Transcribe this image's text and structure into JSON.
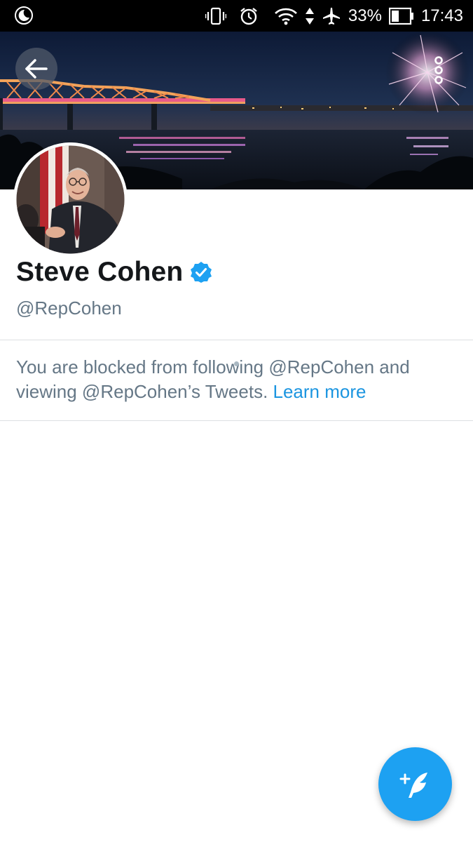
{
  "status_bar": {
    "battery_percent": "33%",
    "time": "17:43",
    "icons": [
      "moon-icon",
      "vibrate-icon",
      "alarm-icon",
      "wifi-icon",
      "data-arrows-icon",
      "airplane-icon",
      "battery-icon"
    ]
  },
  "header": {
    "back_icon": "arrow-left-icon",
    "more_icon": "vertical-dots-icon"
  },
  "profile": {
    "name": "Steve Cohen",
    "verified": true,
    "handle": "@RepCohen"
  },
  "blocked_notice": {
    "text": "You are blocked from following @RepCohen and viewing @RepCohen’s Tweets. ",
    "link_label": "Learn more"
  },
  "compose": {
    "icon": "compose-tweet-icon"
  },
  "colors": {
    "accent": "#1da1f2",
    "link": "#1b95e0",
    "secondary_text": "#657786",
    "primary_text": "#14171a"
  }
}
